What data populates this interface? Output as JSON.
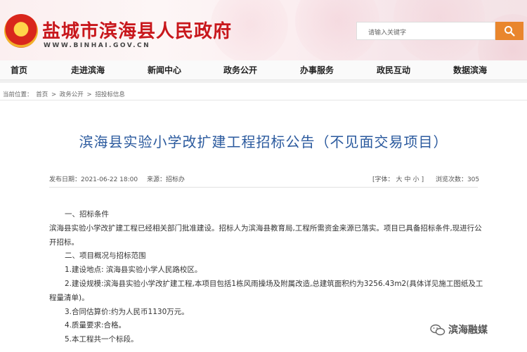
{
  "header": {
    "site_title": "盐城市滨海县人民政府",
    "site_url": "WWW.BINHAI.GOV.CN",
    "search_placeholder": "请输入关键字",
    "accent_color": "#c8171c",
    "search_button_color": "#e9862d",
    "emblem_icon": "national-emblem-icon",
    "search_icon": "search-icon"
  },
  "nav": {
    "items": [
      "首页",
      "走进滨海",
      "新闻中心",
      "政务公开",
      "办事服务",
      "政民互动",
      "数据滨海"
    ]
  },
  "breadcrumb": {
    "label": "当前位置：",
    "items": [
      "首页",
      "政务公开",
      "招投标信息"
    ],
    "separator": ">"
  },
  "article": {
    "title": "滨海县实验小学改扩建工程招标公告（不见面交易项目）",
    "publish_date": "发布日期：2021-06-22 18:00",
    "source": "来源：招标办",
    "font_label": "[字体：",
    "font_large": "大",
    "font_medium": "中",
    "font_small": "小",
    "font_close": "]",
    "views": "浏览次数：305",
    "paragraphs": [
      "一、招标条件",
      "滨海县实验小学改扩建工程已经相关部门批准建设。招标人为滨海县教育局,工程所需资金来源已落实。项目已具备招标条件,现进行公开招标。",
      "二、项目概况与招标范围",
      "1.建设地点: 滨海县实验小学人民路校区。",
      "2.建设规模:滨海县实验小学改扩建工程,本项目包括1栋风雨操场及附属改造,总建筑面积约为3256.43m2(具体详见施工图纸及工程量清单)。",
      "3.合同估算价:约为人民币1130万元。",
      "4.质量要求:合格。",
      "5.本工程共一个标段。"
    ]
  },
  "watermark": {
    "text": "滨海融媒",
    "icon": "wechat-icon"
  }
}
